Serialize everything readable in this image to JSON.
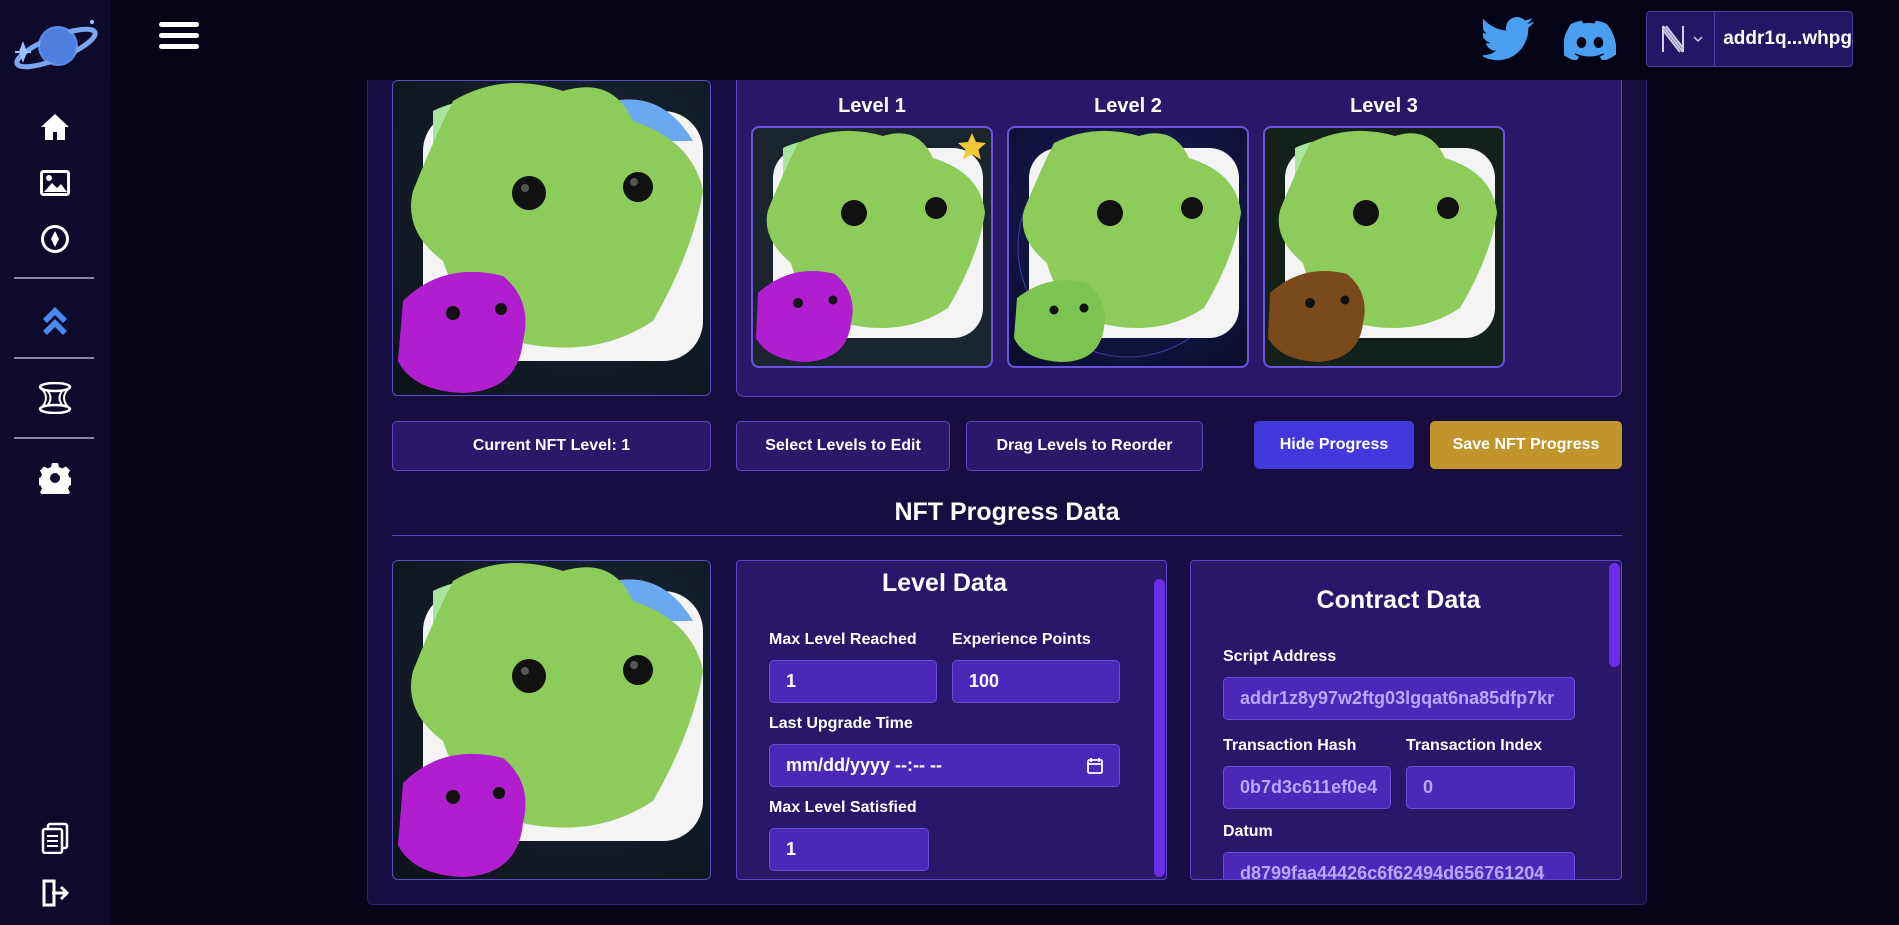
{
  "topbar": {
    "wallet_address": "addr1q...whpg"
  },
  "sidebar": {
    "items": [
      {
        "icon": "home-icon"
      },
      {
        "icon": "image-icon"
      },
      {
        "icon": "compass-icon"
      },
      {
        "icon": "chevrons-up-icon"
      },
      {
        "icon": "wormhole-icon"
      },
      {
        "icon": "gear-icon"
      },
      {
        "icon": "documents-icon"
      },
      {
        "icon": "logout-icon"
      }
    ]
  },
  "levels": [
    {
      "label": "Level 1",
      "starred": true
    },
    {
      "label": "Level 2",
      "starred": false
    },
    {
      "label": "Level 3",
      "starred": false
    }
  ],
  "actions": {
    "current_level": "Current NFT Level: 1",
    "select_levels": "Select Levels to Edit",
    "drag_levels": "Drag Levels to Reorder",
    "hide_progress": "Hide Progress",
    "save_progress": "Save NFT Progress"
  },
  "progress": {
    "title": "NFT Progress Data",
    "level_data": {
      "title": "Level Data",
      "max_level_reached_label": "Max Level Reached",
      "max_level_reached_value": "1",
      "experience_points_label": "Experience Points",
      "experience_points_value": "100",
      "last_upgrade_time_label": "Last Upgrade Time",
      "last_upgrade_time_value": "mm/dd/yyyy --:-- --",
      "max_level_satisfied_label": "Max Level Satisfied",
      "max_level_satisfied_value": "1"
    },
    "contract_data": {
      "title": "Contract Data",
      "script_address_label": "Script Address",
      "script_address_value": "addr1z8y97w2ftg03lgqat6na85dfp7kr",
      "tx_hash_label": "Transaction Hash",
      "tx_hash_value": "0b7d3c611ef0e4",
      "tx_index_label": "Transaction Index",
      "tx_index_value": "0",
      "datum_label": "Datum",
      "datum_value": "d8799faa44426c6f62494d656761204"
    }
  },
  "colors": {
    "background": "#07061a",
    "sidebar": "#0e0a2c",
    "panel": "#29176a",
    "accent_blue": "#4338dc",
    "accent_gold": "#c2952c",
    "creature_green": "#8fd35a",
    "creature_purple": "#b21ed4",
    "creature_brown": "#7a4a1a"
  }
}
